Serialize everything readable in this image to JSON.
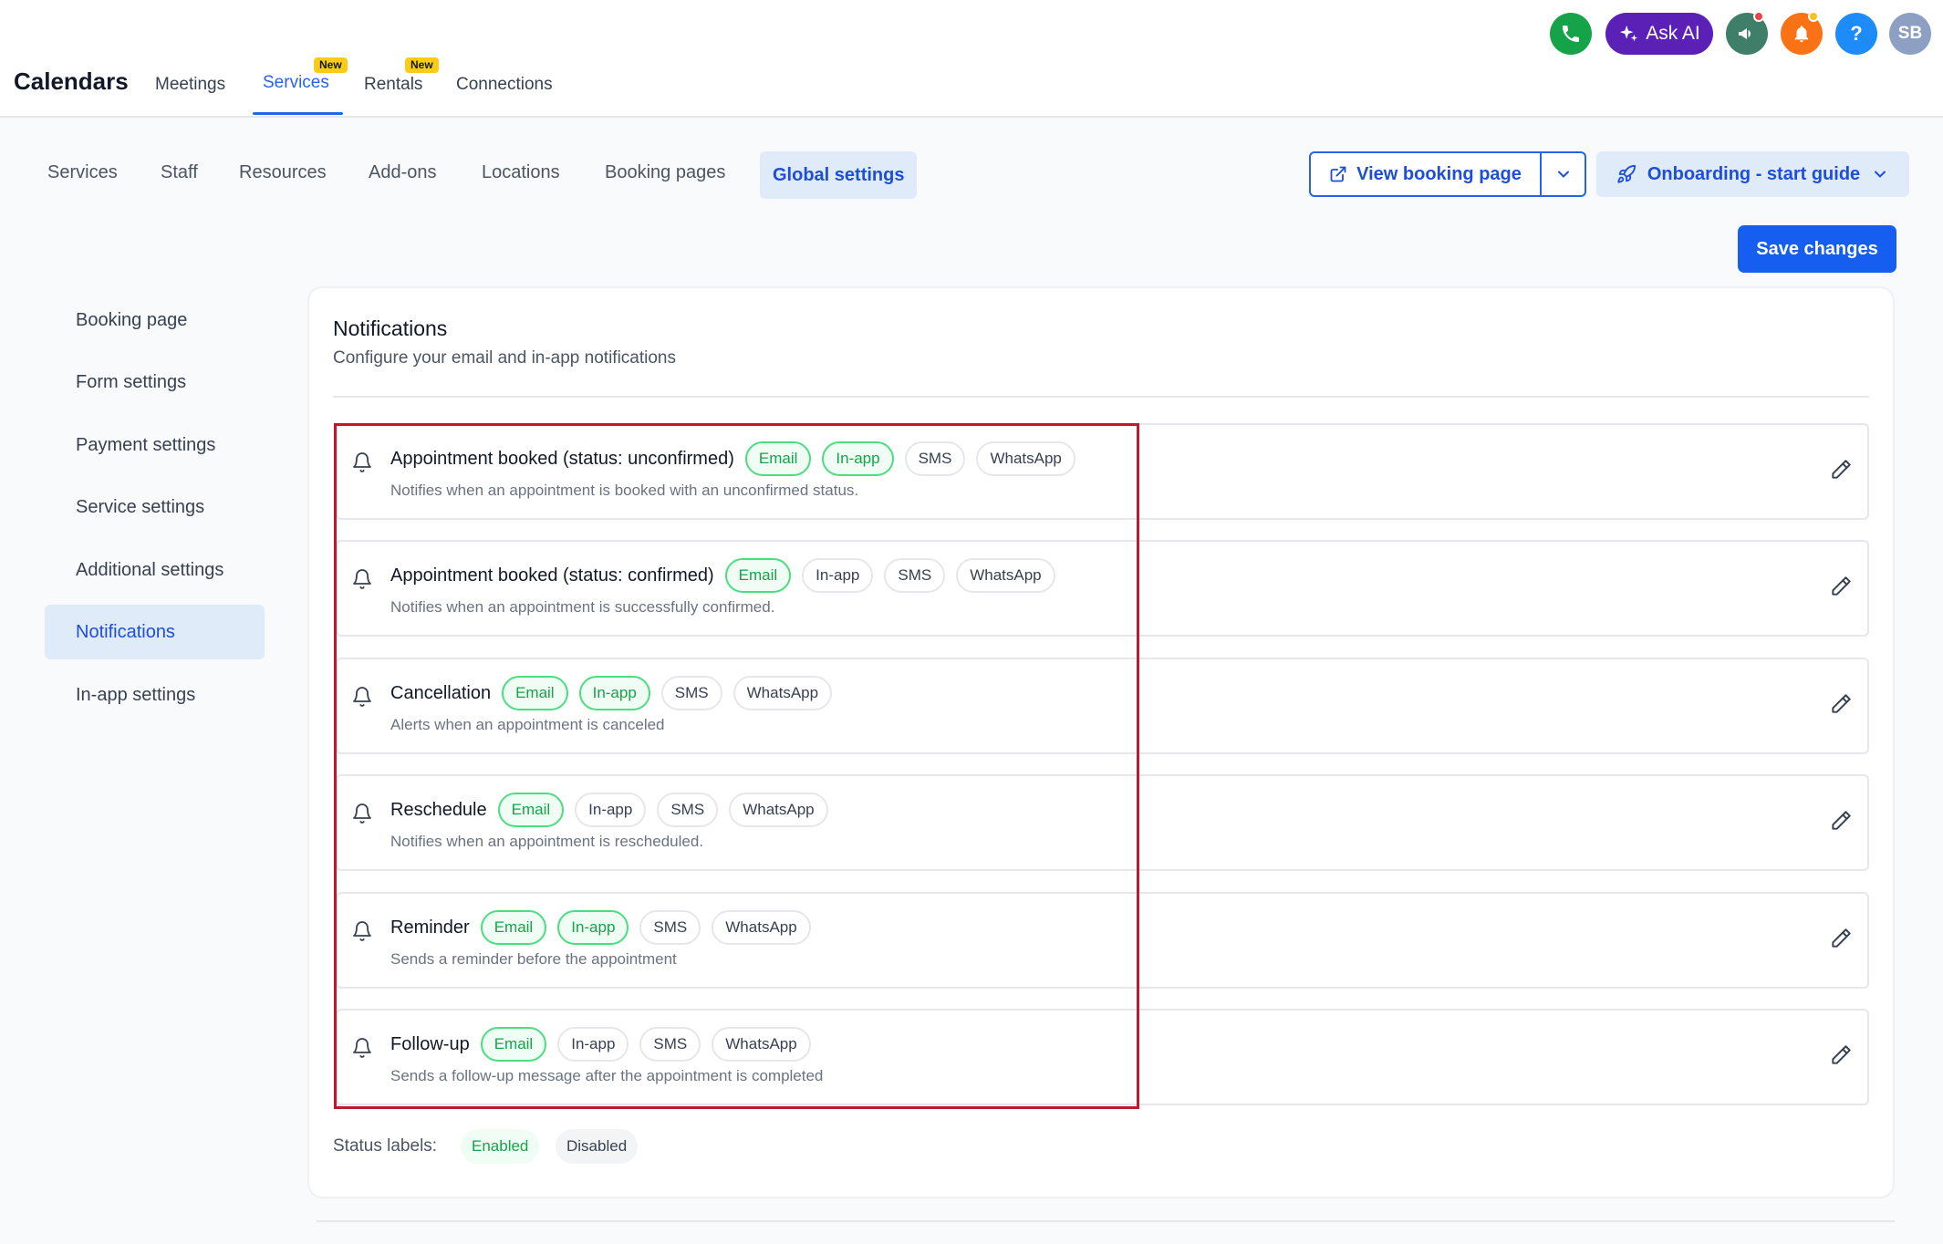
{
  "app": {
    "title": "Calendars"
  },
  "top_tabs": [
    {
      "label": "Meetings"
    },
    {
      "label": "Services",
      "badge": "New"
    },
    {
      "label": "Rentals",
      "badge": "New"
    },
    {
      "label": "Connections"
    }
  ],
  "top_actions": {
    "ask_ai": "Ask AI",
    "help": "?",
    "avatar": "SB"
  },
  "sub_tabs": [
    "Services",
    "Staff",
    "Resources",
    "Add-ons",
    "Locations",
    "Booking pages",
    "Global settings"
  ],
  "buttons": {
    "view_booking": "View booking page",
    "onboarding": "Onboarding - start guide",
    "save": "Save changes"
  },
  "left_nav": [
    "Booking page",
    "Form settings",
    "Payment settings",
    "Service settings",
    "Additional settings",
    "Notifications",
    "In-app settings"
  ],
  "notifications": {
    "title": "Notifications",
    "subtitle": "Configure your email and in-app notifications",
    "items": [
      {
        "name": "Appointment booked (status: unconfirmed)",
        "desc": "Notifies when an appointment is booked with an unconfirmed status.",
        "channels": [
          {
            "label": "Email",
            "on": true
          },
          {
            "label": "In-app",
            "on": true
          },
          {
            "label": "SMS",
            "on": false
          },
          {
            "label": "WhatsApp",
            "on": false
          }
        ]
      },
      {
        "name": "Appointment booked (status: confirmed)",
        "desc": "Notifies when an appointment is successfully confirmed.",
        "channels": [
          {
            "label": "Email",
            "on": true
          },
          {
            "label": "In-app",
            "on": false
          },
          {
            "label": "SMS",
            "on": false
          },
          {
            "label": "WhatsApp",
            "on": false
          }
        ]
      },
      {
        "name": "Cancellation",
        "desc": "Alerts when an appointment is canceled",
        "channels": [
          {
            "label": "Email",
            "on": true
          },
          {
            "label": "In-app",
            "on": true
          },
          {
            "label": "SMS",
            "on": false
          },
          {
            "label": "WhatsApp",
            "on": false
          }
        ]
      },
      {
        "name": "Reschedule",
        "desc": "Notifies when an appointment is rescheduled.",
        "channels": [
          {
            "label": "Email",
            "on": true
          },
          {
            "label": "In-app",
            "on": false
          },
          {
            "label": "SMS",
            "on": false
          },
          {
            "label": "WhatsApp",
            "on": false
          }
        ]
      },
      {
        "name": "Reminder",
        "desc": "Sends a reminder before the appointment",
        "channels": [
          {
            "label": "Email",
            "on": true
          },
          {
            "label": "In-app",
            "on": true
          },
          {
            "label": "SMS",
            "on": false
          },
          {
            "label": "WhatsApp",
            "on": false
          }
        ]
      },
      {
        "name": "Follow-up",
        "desc": "Sends a follow-up message after the appointment is completed",
        "channels": [
          {
            "label": "Email",
            "on": true
          },
          {
            "label": "In-app",
            "on": false
          },
          {
            "label": "SMS",
            "on": false
          },
          {
            "label": "WhatsApp",
            "on": false
          }
        ]
      }
    ],
    "status_labels": {
      "label": "Status labels:",
      "enabled": "Enabled",
      "disabled": "Disabled"
    }
  },
  "colors": {
    "accent": "#2563eb",
    "enabled_green": "#16a34a",
    "highlight_red": "#c0182e",
    "askai_purple": "#5b21b6"
  }
}
